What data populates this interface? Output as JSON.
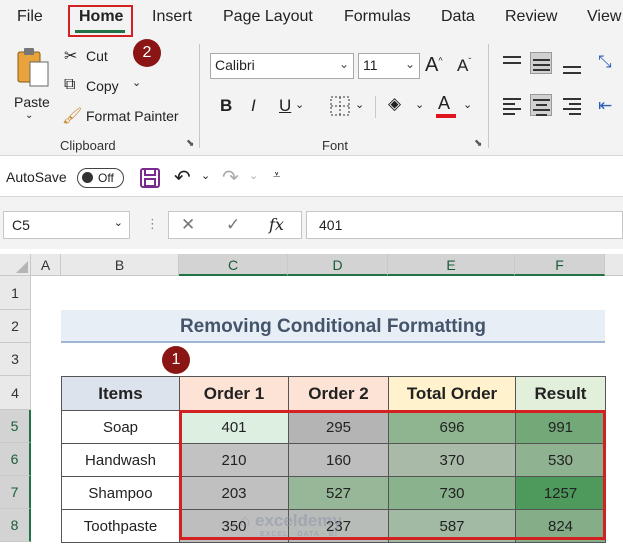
{
  "menu": {
    "tabs": [
      "File",
      "Home",
      "Insert",
      "Page Layout",
      "Formulas",
      "Data",
      "Review",
      "View"
    ],
    "active": "Home"
  },
  "ribbon": {
    "clipboard": {
      "paste": "Paste",
      "cut": "Cut",
      "copy": "Copy",
      "format_painter": "Format Painter",
      "label": "Clipboard"
    },
    "font": {
      "font_name": "Calibri",
      "font_size": "11",
      "bold": "B",
      "italic": "I",
      "underline": "U",
      "label": "Font",
      "font_color": "#e0141e"
    },
    "badge_home": "2"
  },
  "qat": {
    "autosave": "AutoSave",
    "toggle": "Off"
  },
  "formula_bar": {
    "name_box": "C5",
    "fx": "fx",
    "value": "401"
  },
  "grid": {
    "columns": [
      "A",
      "B",
      "C",
      "D",
      "E",
      "F"
    ],
    "rows": [
      "1",
      "2",
      "3",
      "4",
      "5",
      "6",
      "7",
      "8"
    ],
    "title": "Removing Conditional Formatting",
    "badge_table": "1",
    "headers": [
      "Items",
      "Order 1",
      "Order 2",
      "Total Order",
      "Result"
    ],
    "header_colors": [
      "#dde3ec",
      "#fde2d6",
      "#fde2d6",
      "#fff2cc",
      "#e2efda"
    ],
    "data": [
      [
        "Soap",
        "401",
        "295",
        "696",
        "991"
      ],
      [
        "Handwash",
        "210",
        "160",
        "370",
        "530"
      ],
      [
        "Shampoo",
        "203",
        "527",
        "730",
        "1257"
      ],
      [
        "Toothpaste",
        "350",
        "237",
        "587",
        "824"
      ]
    ],
    "cell_colors": [
      [
        "#ffffff",
        "#dcefe0",
        "#b4b4b4",
        "#8fb590",
        "#73a878"
      ],
      [
        "#ffffff",
        "#c2c2c2",
        "#bdbdbd",
        "#a9bba8",
        "#8fb390"
      ],
      [
        "#ffffff",
        "#c0c0c0",
        "#97b898",
        "#8ab28c",
        "#4e9a5c"
      ],
      [
        "#ffffff",
        "#bebebe",
        "#b8bcb8",
        "#a2b9a3",
        "#84ad88"
      ]
    ],
    "watermark": "exceldemy",
    "watermark_sub": "EXCEL · DATA · BI"
  }
}
